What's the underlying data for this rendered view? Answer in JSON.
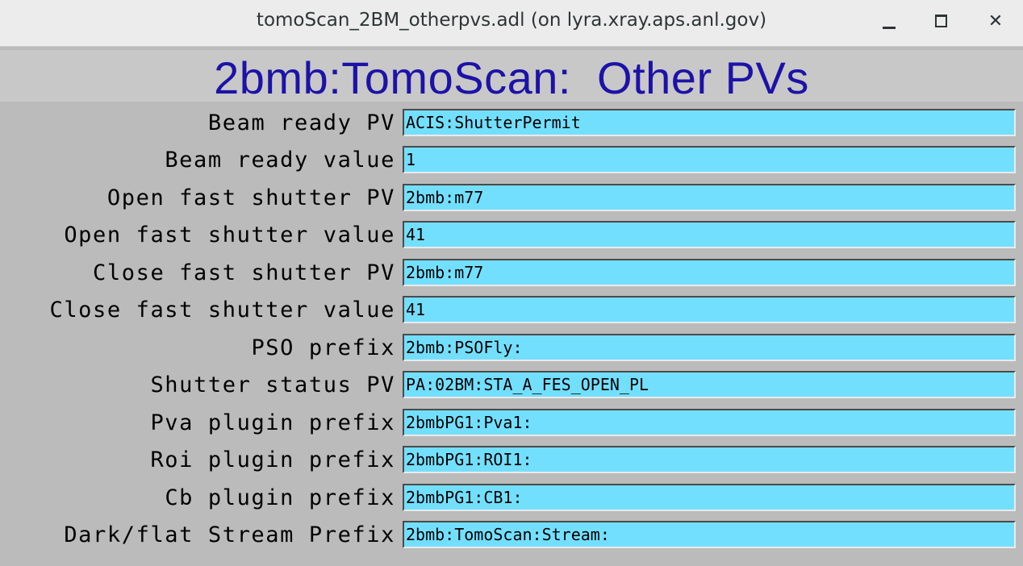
{
  "window": {
    "title": "tomoScan_2BM_otherpvs.adl (on lyra.xray.aps.anl.gov)",
    "controls": {
      "minimize_icon": "minimize-icon",
      "maximize_icon": "maximize-icon",
      "close_icon": "close-icon",
      "close_glyph": "✕"
    }
  },
  "banner": {
    "title": "2bmb:TomoScan:  Other PVs",
    "color": "#1d12a7"
  },
  "colors": {
    "field_background": "#73dfff",
    "panel_background": "#bbbbbb"
  },
  "fields": [
    {
      "label": "Beam ready PV",
      "value": "ACIS:ShutterPermit"
    },
    {
      "label": "Beam ready value",
      "value": "1"
    },
    {
      "label": "Open fast shutter PV",
      "value": "2bmb:m77"
    },
    {
      "label": "Open fast shutter value",
      "value": "41"
    },
    {
      "label": "Close fast shutter PV",
      "value": "2bmb:m77"
    },
    {
      "label": "Close fast shutter value",
      "value": "41"
    },
    {
      "label": "PSO prefix",
      "value": "2bmb:PSOFly:"
    },
    {
      "label": "Shutter status PV",
      "value": "PA:02BM:STA_A_FES_OPEN_PL"
    },
    {
      "label": "Pva plugin prefix",
      "value": "2bmbPG1:Pva1:"
    },
    {
      "label": "Roi plugin prefix",
      "value": "2bmbPG1:ROI1:"
    },
    {
      "label": "Cb plugin prefix",
      "value": "2bmbPG1:CB1:"
    },
    {
      "label": "Dark/flat Stream Prefix",
      "value": "2bmb:TomoScan:Stream:"
    }
  ]
}
